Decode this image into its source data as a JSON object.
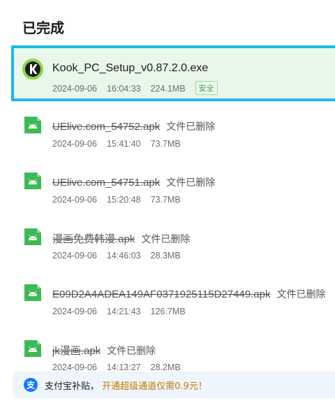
{
  "section_title": "已完成",
  "downloads": [
    {
      "name": "Kook_PC_Setup_v0.87.2.0.exe",
      "date": "2024-09-06",
      "time": "16:04:33",
      "size": "224.1MB",
      "badge": "安全",
      "status": "",
      "icon": "kook-app-icon",
      "deleted": false,
      "selected": true
    },
    {
      "name": "UElive.com_54752.apk",
      "date": "2024-09-06",
      "time": "15:41:40",
      "size": "73.7MB",
      "badge": "",
      "status": "文件已删除",
      "icon": "android-apk-icon",
      "deleted": true,
      "selected": false
    },
    {
      "name": "UElive.com_54751.apk",
      "date": "2024-09-06",
      "time": "15:20:48",
      "size": "73.7MB",
      "badge": "",
      "status": "文件已删除",
      "icon": "android-apk-icon",
      "deleted": true,
      "selected": false
    },
    {
      "name": "漫画免费韩漫.apk",
      "date": "2024-09-06",
      "time": "14:46:03",
      "size": "28.3MB",
      "badge": "",
      "status": "文件已删除",
      "icon": "android-apk-icon",
      "deleted": true,
      "selected": false
    },
    {
      "name": "E09D2A4ADEA149AF0371925115D27449.apk",
      "date": "2024-09-06",
      "time": "14:21:43",
      "size": "126.7MB",
      "badge": "",
      "status": "文件已删除",
      "icon": "android-apk-icon",
      "deleted": true,
      "selected": false
    },
    {
      "name": "jk漫画.apk",
      "date": "2024-09-06",
      "time": "14:13:27",
      "size": "28.2MB",
      "badge": "",
      "status": "文件已删除",
      "icon": "android-apk-icon",
      "deleted": true,
      "selected": false
    }
  ],
  "banner": {
    "label": "支付宝补贴，",
    "offer": "开通超级通道仅需0.9元！",
    "icon": "alipay-icon"
  },
  "colors": {
    "selected_bg": "#e8f7ea",
    "selected_border": "#19b8f0",
    "apk_green": "#3dba55",
    "kook_green": "#8ed53f",
    "badge_green": "#3aa64a",
    "offer_orange": "#c87800",
    "alipay_blue": "#1677ff"
  }
}
